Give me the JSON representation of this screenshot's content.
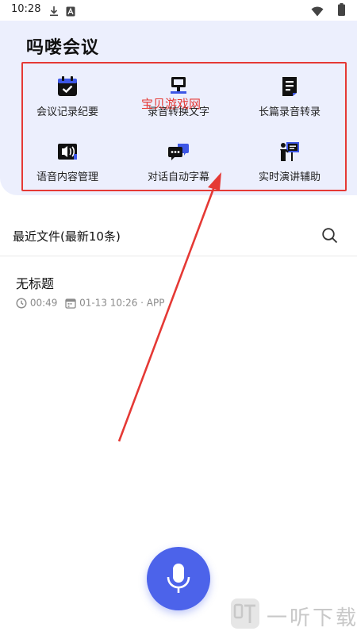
{
  "status_bar": {
    "time": "10:28",
    "icons": [
      "download-icon",
      "app-a-icon",
      "wifi-icon",
      "battery-icon"
    ]
  },
  "header": {
    "title": "吗喽会议",
    "background": "#eceffd"
  },
  "features": [
    {
      "label": "会议记录纪要",
      "icon": "calendar-check-icon"
    },
    {
      "label": "录音转换文字",
      "icon": "monitor-icon"
    },
    {
      "label": "长篇录音转录",
      "icon": "document-icon"
    },
    {
      "label": "语音内容管理",
      "icon": "audio-card-icon"
    },
    {
      "label": "对话自动字幕",
      "icon": "chat-bubbles-icon"
    },
    {
      "label": "实时演讲辅助",
      "icon": "presenter-icon"
    }
  ],
  "annotation": {
    "watermark_text": "宝贝游戏网",
    "color": "#e53935"
  },
  "recent": {
    "title": "最近文件(最新10条)",
    "search_icon": "search-icon",
    "files": [
      {
        "title": "无标题",
        "duration": "00:49",
        "date_source": "01-13 10:26 · APP"
      }
    ]
  },
  "mic": {
    "icon": "microphone-icon",
    "color": "#4c63ea"
  },
  "watermark": {
    "text": "一听下载",
    "logo": "yiting-logo-icon"
  }
}
